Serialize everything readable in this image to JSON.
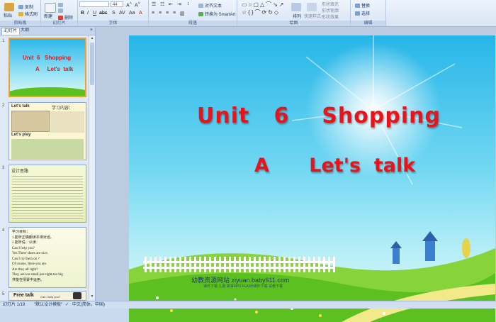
{
  "ribbon": {
    "clipboard": {
      "paste": "粘贴",
      "copy": "复制",
      "format_painter": "格式刷",
      "label": "剪贴板"
    },
    "slides": {
      "new_slide": "新建",
      "delete": "删除",
      "label": "幻灯片"
    },
    "font": {
      "size": "44",
      "label": "字体"
    },
    "paragraph": {
      "align_text": "对齐文本",
      "smartart": "转换为 SmartArt",
      "label": "段落"
    },
    "drawing": {
      "arrange": "排列",
      "quick_styles": "快速样式",
      "shape_fill": "形状填充",
      "shape_outline": "形状轮廓",
      "shape_effects": "形状效果",
      "label": "绘图"
    },
    "editing": {
      "replace": "替换",
      "select": "选择",
      "label": "编辑"
    }
  },
  "panel": {
    "tabs": {
      "slides": "幻灯片",
      "outline": "大纲",
      "close": "×"
    },
    "thumbs": [
      {
        "num": "1",
        "line1": "Unit  6   Shopping",
        "line2": "A     Let's  talk"
      },
      {
        "num": "2",
        "heading": "Let's talk",
        "heading2": "Let's play",
        "note": "学习内容："
      },
      {
        "num": "3",
        "heading": "设计思路"
      },
      {
        "num": "4",
        "heading": "学习目标：",
        "lines": [
          "1.能听正确朗读本课对话。",
          "2.能听说、认读：",
          "Can I help you?",
          "Yes.These shoes are nice.",
          "Can I try them on ?",
          "Of course. Here you are.",
          "Are they all right?",
          "They are too small.just right.too big",
          "并能在情景中运用。"
        ]
      },
      {
        "num": "5",
        "heading": "Free talk",
        "note": "Can I help you?"
      }
    ]
  },
  "slide": {
    "title_line1": "Unit   6    Shopping",
    "title_line2": "A      Let's  talk",
    "footer": "幼教资源网站   ziyuan.baby611.com",
    "footer_small": "课件下载    儿歌    故事MP3    FLASH课件下载    试卷下载"
  },
  "status": {
    "slide_count": "幻灯片 1/19",
    "theme": "\"默认设计模板\"",
    "language": "中文(简体，中国)"
  },
  "colors": {
    "title_red": "#e8141b",
    "sky_top": "#27b6e8",
    "grass": "#5cc020"
  }
}
